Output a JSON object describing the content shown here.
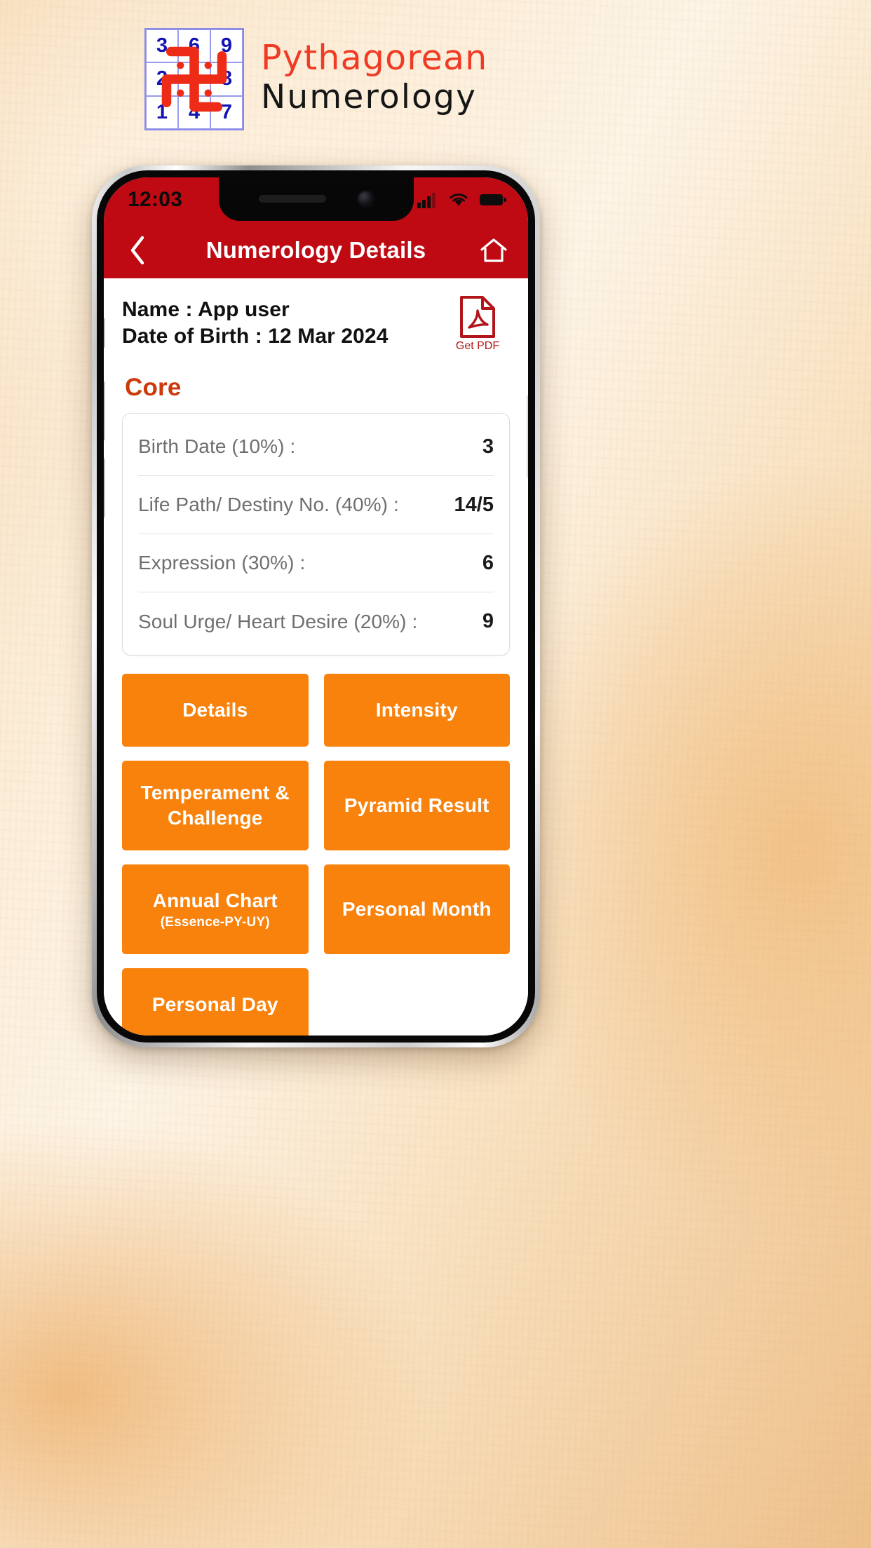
{
  "logo": {
    "square_numbers": [
      "3",
      "6",
      "9",
      "2",
      "",
      "8",
      "1",
      "4",
      "7"
    ],
    "swastika_icon": "swastika-icon",
    "title_line1": "Pythagorean",
    "title_line2": "Numerology",
    "color_red": "#ef3b25",
    "color_dark": "#161616",
    "grid_color": "#1414b4"
  },
  "phone": {
    "statusbar": {
      "time": "12:03",
      "icons": [
        "signal-icon",
        "wifi-icon",
        "battery-icon"
      ]
    },
    "appbar": {
      "back_icon": "back-chevron-icon",
      "title": "Numerology Details",
      "home_icon": "home-icon",
      "bg_color": "#bf0a14"
    },
    "profile": {
      "name_line": "Name : App  user",
      "dob_line": "Date of Birth : 12 Mar 2024",
      "pdf_icon": "pdf-file-icon",
      "pdf_label": "Get PDF"
    },
    "core": {
      "section_title": "Core",
      "rows": [
        {
          "label": "Birth Date (10%) :",
          "value": "3"
        },
        {
          "label": "Life Path/ Destiny No. (40%) :",
          "value": "14/5"
        },
        {
          "label": "Expression (30%) :",
          "value": "6"
        },
        {
          "label": "Soul Urge/ Heart Desire (20%) :",
          "value": "9"
        }
      ]
    },
    "buttons": [
      {
        "main": "Details",
        "sub": ""
      },
      {
        "main": "Intensity",
        "sub": ""
      },
      {
        "main": "Temperament & Challenge",
        "sub": ""
      },
      {
        "main": "Pyramid Result",
        "sub": ""
      },
      {
        "main": "Annual Chart",
        "sub": "(Essence-PY-UY)"
      },
      {
        "main": "Personal Month",
        "sub": ""
      },
      {
        "main": "Personal Day",
        "sub": ""
      }
    ],
    "accent_orange": "#f8820c"
  }
}
